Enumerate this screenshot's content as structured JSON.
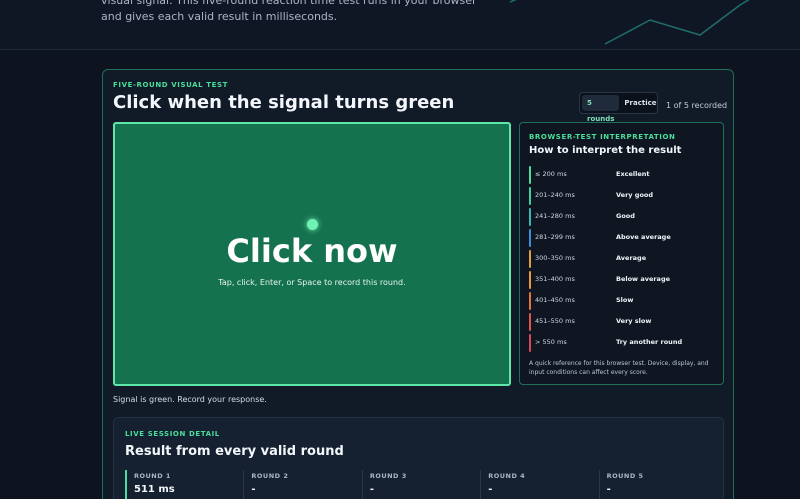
{
  "intro": {
    "text": "visual signal. This five-round reaction time test runs in your browser and gives each valid result in milliseconds."
  },
  "test": {
    "eyebrow": "FIVE-ROUND VISUAL TEST",
    "title": "Click when the signal turns green",
    "modes": [
      "5 rounds",
      "Practice"
    ],
    "active_mode": "5 rounds",
    "recorded": "1 of 5 recorded"
  },
  "signal": {
    "main": "Click now",
    "sub": "Tap, click, Enter, or Space to record this round.",
    "status": "Signal is green. Record your response.",
    "color": "#15724f"
  },
  "interpretation": {
    "eyebrow": "BROWSER-TEST INTERPRETATION",
    "title": "How to interpret the result",
    "rows": [
      {
        "range": "≤ 200 ms",
        "rating": "Excellent",
        "color": "#4ade9a"
      },
      {
        "range": "201–240 ms",
        "rating": "Very good",
        "color": "#3fcf9a"
      },
      {
        "range": "241–280 ms",
        "rating": "Good",
        "color": "#38b8b0"
      },
      {
        "range": "281–299 ms",
        "rating": "Above average",
        "color": "#3b8fd6"
      },
      {
        "range": "300–350 ms",
        "rating": "Average",
        "color": "#e0a23a"
      },
      {
        "range": "351–400 ms",
        "rating": "Below average",
        "color": "#e89a3c"
      },
      {
        "range": "401–450 ms",
        "rating": "Slow",
        "color": "#e8743c"
      },
      {
        "range": "451–550 ms",
        "rating": "Very slow",
        "color": "#e0564a"
      },
      {
        "range": "> 550 ms",
        "rating": "Try another round",
        "color": "#d9485a"
      }
    ],
    "note": "A quick reference for this browser test. Device, display, and input conditions can affect every score."
  },
  "session": {
    "eyebrow": "LIVE SESSION DETAIL",
    "title": "Result from every valid round",
    "rounds": [
      {
        "label": "ROUND 1",
        "value": "511 ms"
      },
      {
        "label": "ROUND 2",
        "value": "-"
      },
      {
        "label": "ROUND 3",
        "value": "-"
      },
      {
        "label": "ROUND 4",
        "value": "-"
      },
      {
        "label": "ROUND 5",
        "value": "-"
      }
    ]
  },
  "colors": {
    "accent": "#4ade9a",
    "background": "#0d1420",
    "card_border": "#1f6e56"
  }
}
